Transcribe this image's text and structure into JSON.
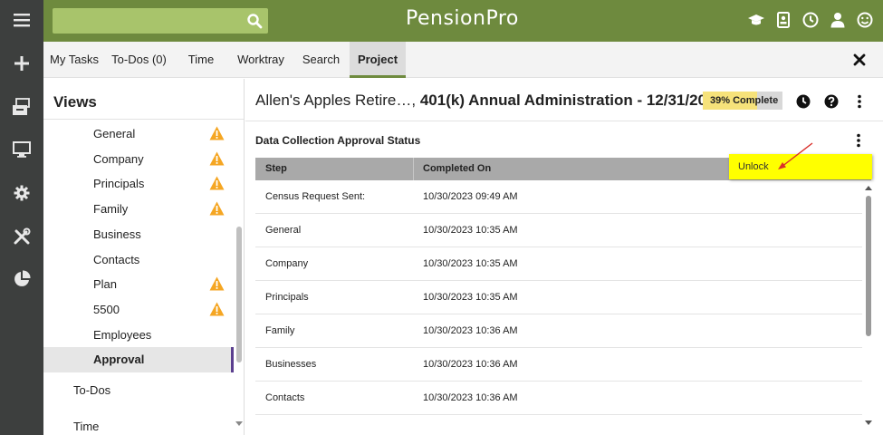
{
  "app": {
    "brand": "PensionPro"
  },
  "search": {
    "placeholder": ""
  },
  "tabs": [
    {
      "label": "My Tasks"
    },
    {
      "label": "To-Dos (0)"
    },
    {
      "label": "Time"
    },
    {
      "label": "Worktray"
    },
    {
      "label": "Search"
    },
    {
      "label": "Project"
    }
  ],
  "active_tab": "Project",
  "sidebar": {
    "title": "Views",
    "items": [
      {
        "label": "General",
        "warning": true
      },
      {
        "label": "Company",
        "warning": true
      },
      {
        "label": "Principals",
        "warning": true
      },
      {
        "label": "Family",
        "warning": true
      },
      {
        "label": "Business",
        "warning": false
      },
      {
        "label": "Contacts",
        "warning": false
      },
      {
        "label": "Plan",
        "warning": true
      },
      {
        "label": "5500",
        "warning": true
      },
      {
        "label": "Employees",
        "warning": false
      },
      {
        "label": "Approval",
        "warning": false
      }
    ],
    "selected": "Approval",
    "sections": [
      {
        "label": "To-Dos"
      },
      {
        "label": "Time"
      }
    ]
  },
  "project": {
    "title_prefix": "Allen's Apples Retire…,",
    "title_bold": "401(k) Annual Administration - 12/31/2023",
    "progress_label": "39% Complete",
    "progress": 0.39
  },
  "card": {
    "title": "Data Collection Approval Status",
    "columns": [
      "Step",
      "Completed On"
    ],
    "rows": [
      {
        "step": "Census Request Sent:",
        "completed": "10/30/2023 09:49 AM"
      },
      {
        "step": "General",
        "completed": "10/30/2023 10:35 AM"
      },
      {
        "step": "Company",
        "completed": "10/30/2023 10:35 AM"
      },
      {
        "step": "Principals",
        "completed": "10/30/2023 10:35 AM"
      },
      {
        "step": "Family",
        "completed": "10/30/2023 10:36 AM"
      },
      {
        "step": "Businesses",
        "completed": "10/30/2023 10:36 AM"
      },
      {
        "step": "Contacts",
        "completed": "10/30/2023 10:36 AM"
      }
    ]
  },
  "menu": {
    "unlock_label": "Unlock"
  },
  "colors": {
    "topbar": "#6e8a3e",
    "rail": "#3d3f3e",
    "search": "#a8c46b",
    "warning": "#f5a623",
    "highlight": "#ffff00",
    "selection_bar": "#5b3f8f"
  },
  "icons": {
    "rail": [
      "menu-icon",
      "plus-icon",
      "inbox-icon",
      "monitor-icon",
      "gear-icon",
      "tools-icon",
      "pie-chart-icon"
    ],
    "top": [
      "graduation-cap-icon",
      "contact-card-icon",
      "clock-icon",
      "user-icon",
      "smiley-icon"
    ]
  }
}
